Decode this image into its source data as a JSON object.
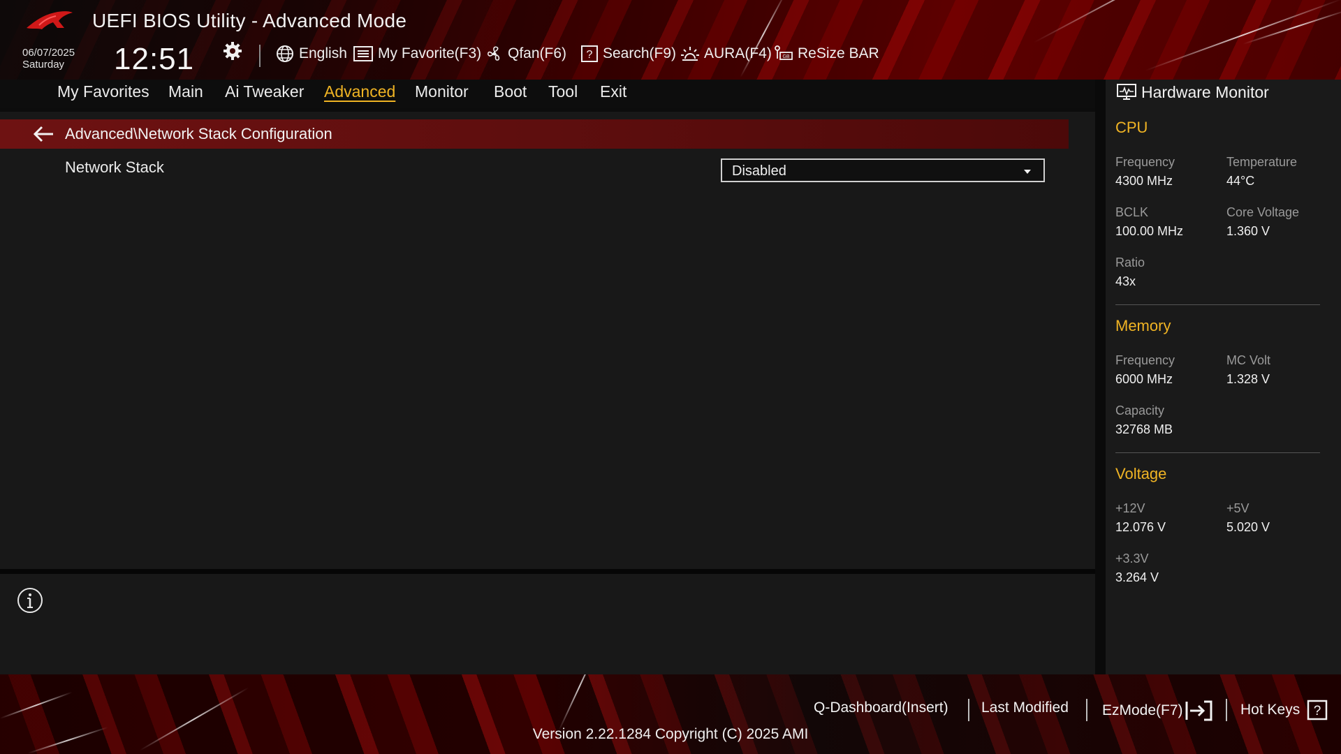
{
  "header": {
    "title": "UEFI BIOS Utility - Advanced Mode",
    "date": "06/07/2025",
    "day": "Saturday",
    "time": "12:51",
    "toolbar": [
      {
        "label": "English",
        "icon": "globe-icon"
      },
      {
        "label": "My Favorite(F3)",
        "icon": "favorite-list-icon"
      },
      {
        "label": "Qfan(F6)",
        "icon": "fan-icon"
      },
      {
        "label": "Search(F9)",
        "icon": "search-question-icon"
      },
      {
        "label": "AURA(F4)",
        "icon": "aura-light-icon"
      },
      {
        "label": "ReSize BAR",
        "icon": "resize-bar-icon"
      }
    ]
  },
  "nav": {
    "tabs": [
      "My Favorites",
      "Main",
      "Ai Tweaker",
      "Advanced",
      "Monitor",
      "Boot",
      "Tool",
      "Exit"
    ],
    "active": "Advanced"
  },
  "main": {
    "breadcrumb": "Advanced\\Network Stack Configuration",
    "settings": [
      {
        "label": "Network Stack",
        "value": "Disabled"
      }
    ]
  },
  "hardware_monitor": {
    "title": "Hardware Monitor",
    "cpu": {
      "heading": "CPU",
      "frequency_label": "Frequency",
      "frequency": "4300 MHz",
      "temperature_label": "Temperature",
      "temperature": "44°C",
      "bclk_label": "BCLK",
      "bclk": "100.00 MHz",
      "core_voltage_label": "Core Voltage",
      "core_voltage": "1.360 V",
      "ratio_label": "Ratio",
      "ratio": "43x"
    },
    "memory": {
      "heading": "Memory",
      "frequency_label": "Frequency",
      "frequency": "6000 MHz",
      "mc_volt_label": "MC Volt",
      "mc_volt": "1.328 V",
      "capacity_label": "Capacity",
      "capacity": "32768 MB"
    },
    "voltage": {
      "heading": "Voltage",
      "v12_label": "+12V",
      "v12": "12.076 V",
      "v5_label": "+5V",
      "v5": "5.020 V",
      "v33_label": "+3.3V",
      "v33": "3.264 V"
    }
  },
  "footer": {
    "items": [
      "Q-Dashboard(Insert)",
      "Last Modified",
      "EzMode(F7)",
      "Hot Keys"
    ],
    "version": "Version 2.22.1284 Copyright (C) 2025 AMI"
  },
  "colors": {
    "accent": "#f0b424",
    "brand_red": "#6e1212"
  }
}
